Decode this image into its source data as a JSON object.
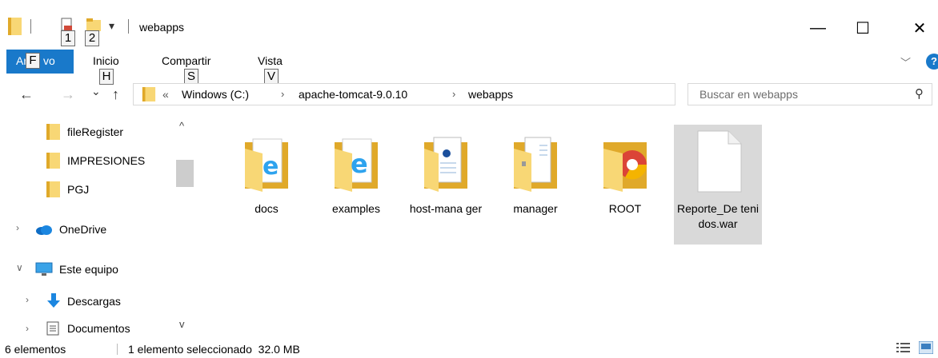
{
  "window": {
    "title": "webapps",
    "minimize_glyph": "—",
    "maximize_glyph": "☐",
    "close_glyph": "✕"
  },
  "quick_access": {
    "dropdown_glyph": "▾",
    "keytip_1": "1",
    "keytip_2": "2"
  },
  "ribbon": {
    "file_tab": "Ar",
    "file_tab_tail": "vo",
    "file_keytip": "F",
    "tabs": [
      {
        "label": "Inicio",
        "keytip": "H"
      },
      {
        "label": "Compartir",
        "keytip": "S"
      },
      {
        "label": "Vista",
        "keytip": "V"
      }
    ],
    "expand_glyph": "﹀",
    "help_glyph": "?"
  },
  "nav": {
    "back_glyph": "←",
    "forward_glyph": "→",
    "recent_glyph": "⌄",
    "up_glyph": "↑",
    "overflow_glyph": "«",
    "breadcrumbs": [
      "Windows (C:)",
      "apache-tomcat-9.0.10",
      "webapps"
    ],
    "separator_glyph": "›",
    "address_dropdown_glyph": "∨",
    "refresh_glyph": "↻"
  },
  "search": {
    "placeholder": "Buscar en webapps",
    "icon_glyph": "⚲"
  },
  "sidebar": {
    "scroll_up_glyph": "^",
    "scroll_down_glyph": "v",
    "items": [
      {
        "label": "fileRegister",
        "icon": "folder-icon"
      },
      {
        "label": "IMPRESIONES",
        "icon": "folder-icon"
      },
      {
        "label": "PGJ",
        "icon": "folder-icon"
      },
      {
        "label": "OneDrive",
        "icon": "onedrive-icon",
        "chevron": "›"
      },
      {
        "label": "Este equipo",
        "icon": "computer-icon",
        "chevron": "∨"
      },
      {
        "label": "Descargas",
        "icon": "downloads-icon",
        "chevron": "›"
      },
      {
        "label": "Documentos",
        "icon": "documents-icon",
        "chevron": "›"
      }
    ]
  },
  "files": [
    {
      "name": "docs",
      "type": "folder-ie-icon",
      "selected": false
    },
    {
      "name": "examples",
      "type": "folder-ie-icon",
      "selected": false
    },
    {
      "name": "host-mana ger",
      "type": "folder-doc-icon",
      "selected": false
    },
    {
      "name": "manager",
      "type": "folder-doc-icon",
      "selected": false
    },
    {
      "name": "ROOT",
      "type": "folder-chrome-icon",
      "selected": false
    },
    {
      "name": "Reporte_De tenidos.war",
      "type": "blank-file-icon",
      "selected": true
    }
  ],
  "status": {
    "count": "6 elementos",
    "selection": "1 elemento seleccionado  32.0 MB"
  },
  "colors": {
    "accent": "#1979ca",
    "folder_yellow": "#f8d775",
    "folder_dark": "#e0a92a",
    "selection": "#d9d9d9"
  }
}
